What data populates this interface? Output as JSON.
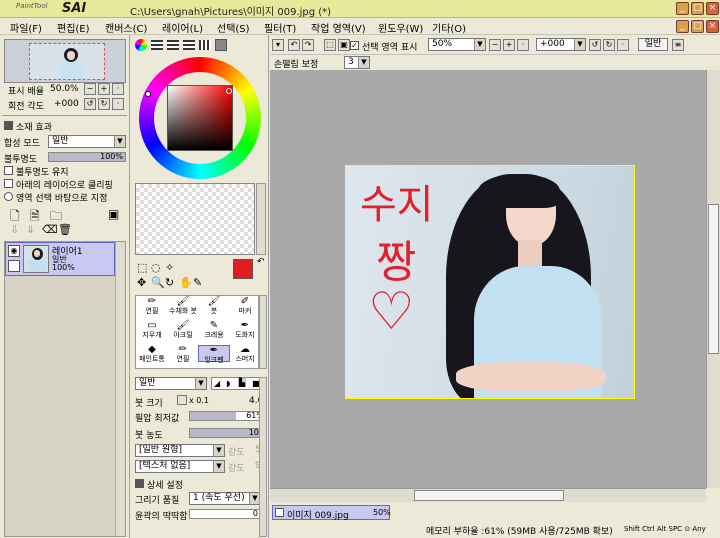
{
  "window": {
    "title": "C:\\Users\\gnah\\Pictures\\이미지 009.jpg (*)",
    "logo_small": "PaintTool",
    "logo_big": "SAI",
    "min": "_",
    "max": "□",
    "close": "×"
  },
  "menu": [
    "파일(F)",
    "편집(E)",
    "캔버스(C)",
    "레이어(L)",
    "선택(S)",
    "필터(T)",
    "작업 영역(V)",
    "윈도우(W)",
    "기타(O)"
  ],
  "doc_controls": {
    "min": "_",
    "max": "□",
    "close": "×"
  },
  "navigator": {
    "zoom_label": "표시 배율",
    "zoom_value": "50.0%",
    "angle_label": "회전 각도",
    "angle_value": "+000"
  },
  "layer_panel": {
    "effects_label": "소재 효과",
    "blend_label": "합성 모드",
    "blend_value": "일반",
    "opacity_label": "불투명도",
    "opacity_value": "100%",
    "opacity_fraction": 1.0,
    "keep_opacity": "불투명도 유지",
    "clip_below": "아래의 레이어으로 클리핑",
    "sel_source": "영역 선택 바탕으로 지정",
    "layer_name": "레이어1",
    "layer_mode": "일반",
    "layer_opacity": "100%"
  },
  "toolbar": {
    "selection_display": "선택 영역 표시",
    "zoom": "50%",
    "angle": "+000",
    "mode": "일반",
    "stabilizer_label": "손떨림 보정",
    "stabilizer_value": "3"
  },
  "canvas": {
    "handwriting_line1": "수지",
    "handwriting_line2": "짱",
    "heart": "♡"
  },
  "tools": [
    [
      "연필",
      "수채화 붓",
      "붓",
      "마커"
    ],
    [
      "지우개",
      "아크릴",
      "크레용",
      "도화지"
    ],
    [
      "페인트통",
      "연필",
      "잉크펜",
      "스머지"
    ]
  ],
  "brush": {
    "mode": "일반",
    "size_label": "붓 크기",
    "size_mult": "x 0.1",
    "size_value": "4.0",
    "min_size_label": "필압 최저값",
    "min_size_value": "61%",
    "min_size_fraction": 0.61,
    "density_label": "붓 농도",
    "density_value": "100",
    "density_fraction": 1.0,
    "shape": "[일반 원형]",
    "shape_val": "강도",
    "shape_num": "50",
    "texture": "[텍스처 없음]",
    "texture_val": "강도",
    "texture_num": "95",
    "detail": "상세 설정",
    "quality_label": "그리기 품질",
    "quality_value": "1 (속도 우선)",
    "edge_label": "윤곽의 딱딱함",
    "edge_value": "0"
  },
  "status": {
    "doc_tab": "이미지 009.jpg",
    "doc_zoom": "50%",
    "memory": "메모리 부하율 :61% (59MB 사용/725MB 확보)",
    "keys": "Shift Ctrl Alt SPC ⊙ Any"
  },
  "colors": {
    "accent": "#e8e89a",
    "primary_color": "#e31b23",
    "canvas_bg": "#a9a9a9",
    "ink": "#e0202a"
  }
}
